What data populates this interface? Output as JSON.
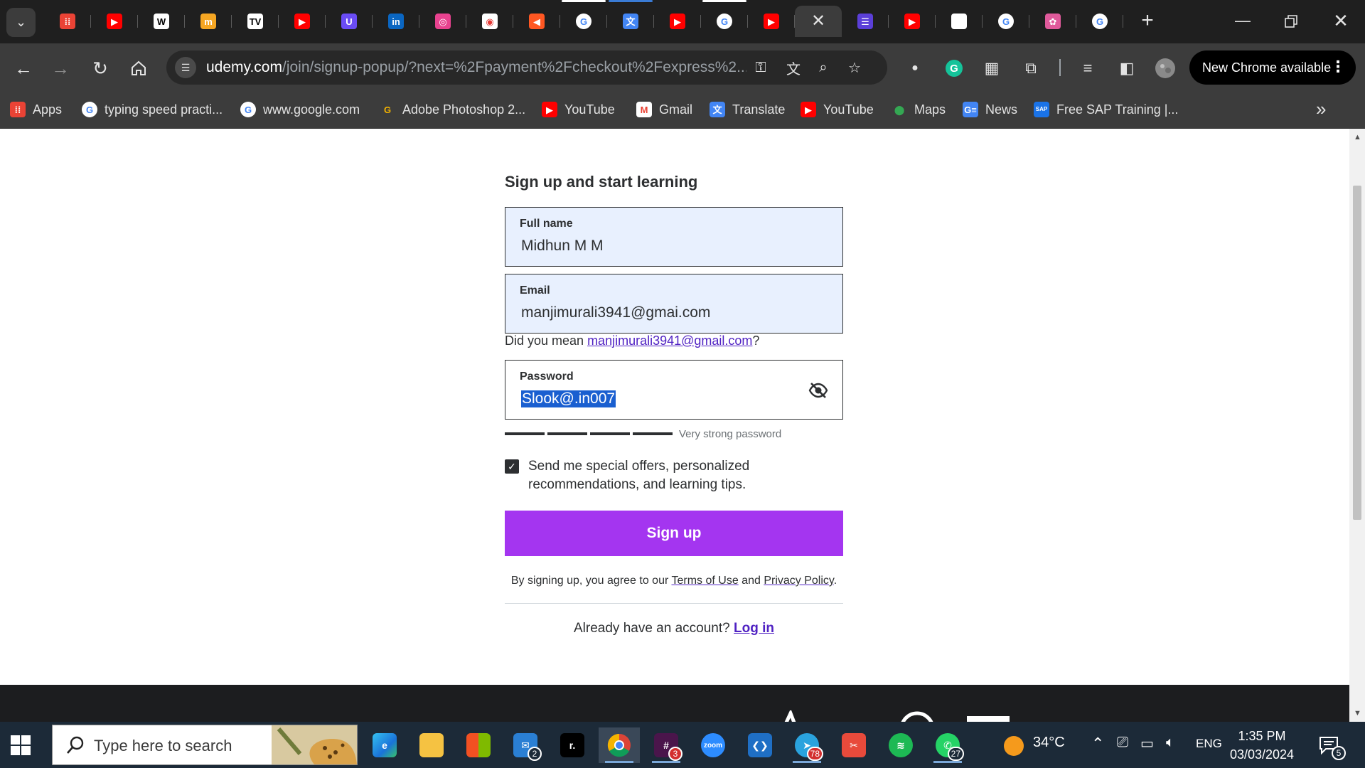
{
  "browser": {
    "tabs": [
      {
        "icon": "apps-grid-icon",
        "color": "#ea4335"
      },
      {
        "icon": "youtube-icon",
        "color": "#ff0000"
      },
      {
        "icon": "wikipedia-icon",
        "color": "#ffffff"
      },
      {
        "icon": "medium-circle-icon",
        "color": "#f5a623"
      },
      {
        "icon": "tradingview-icon",
        "color": "#ffffff"
      },
      {
        "icon": "youtube-icon",
        "color": "#ff0000"
      },
      {
        "icon": "udemy-icon",
        "color": "#6a4cf5"
      },
      {
        "icon": "linkedin-icon",
        "color": "#0a66c2"
      },
      {
        "icon": "swirl-icon",
        "color": "#e8428f"
      },
      {
        "icon": "recorder-icon",
        "color": "#ffffff"
      },
      {
        "icon": "arrow-icon",
        "color": "#ff5722"
      },
      {
        "icon": "google-icon",
        "color": "#ffffff"
      },
      {
        "icon": "google-translate-icon",
        "color": "#4285f4"
      },
      {
        "icon": "youtube-icon",
        "color": "#ff0000"
      },
      {
        "icon": "google-icon",
        "color": "#ffffff"
      },
      {
        "icon": "youtube-icon",
        "color": "#ff0000"
      },
      {
        "icon": "close-icon",
        "active": true
      },
      {
        "icon": "list-icon",
        "color": "#5b3fd8"
      },
      {
        "icon": "youtube-icon",
        "color": "#ff0000"
      },
      {
        "icon": "blank-page-icon",
        "color": "#ffffff"
      },
      {
        "icon": "google-icon",
        "color": "#ffffff"
      },
      {
        "icon": "octopus-icon",
        "color": "#e05a9b"
      },
      {
        "icon": "google-icon",
        "color": "#ffffff"
      }
    ],
    "url_host": "udemy.com",
    "url_path": "/join/signup-popup/?next=%2Fpayment%2Fcheckout%2Fexpress%2...",
    "update_chip": "New Chrome available",
    "bookmarks": [
      {
        "label": "Apps",
        "icon": "apps-grid-icon"
      },
      {
        "label": "typing speed practi...",
        "icon": "google-icon"
      },
      {
        "label": "www.google.com",
        "icon": "google-icon"
      },
      {
        "label": "Adobe Photoshop 2...",
        "icon": "adobe-g-icon"
      },
      {
        "label": "YouTube",
        "icon": "youtube-icon"
      },
      {
        "label": "Gmail",
        "icon": "gmail-icon"
      },
      {
        "label": "Translate",
        "icon": "google-translate-icon"
      },
      {
        "label": "YouTube",
        "icon": "youtube-icon"
      },
      {
        "label": "Maps",
        "icon": "maps-icon"
      },
      {
        "label": "News",
        "icon": "google-news-icon"
      },
      {
        "label": "Free SAP Training |...",
        "icon": "sap-icon"
      }
    ]
  },
  "signup": {
    "heading": "Sign up and start learning",
    "full_name_label": "Full name",
    "full_name_value": "Midhun M M",
    "email_label": "Email",
    "email_value": "manjimurali3941@gmai.com",
    "suggest_prefix": "Did you mean ",
    "suggest_email": "manjimurali3941@gmail.com",
    "suggest_suffix": "?",
    "password_label": "Password",
    "password_value": "Slook@.in007",
    "strength_label": "Very strong password",
    "strength_level": 1.0,
    "optin_text": "Send me special offers, personalized recommendations, and learning tips.",
    "optin_checked": true,
    "signup_button": "Sign up",
    "terms_prefix": "By signing up, you agree to our ",
    "terms_link": "Terms of Use",
    "terms_and": " and ",
    "privacy_link": "Privacy Policy",
    "terms_suffix": ".",
    "login_prompt": "Already have an account? ",
    "login_link": "Log in"
  },
  "taskbar": {
    "search_placeholder": "Type here to search",
    "mail_badge": "2",
    "slack_badge": "3",
    "telegram_badge": "78",
    "whatsapp_badge": "27",
    "temperature": "34°C",
    "language": "ENG",
    "time": "1:35 PM",
    "date": "03/03/2024",
    "notifications": "5"
  },
  "colors": {
    "brand_purple": "#a435f0",
    "link_purple": "#5022c3",
    "text_dark": "#2d2f31",
    "autofill_bg": "#e8f0fe"
  }
}
